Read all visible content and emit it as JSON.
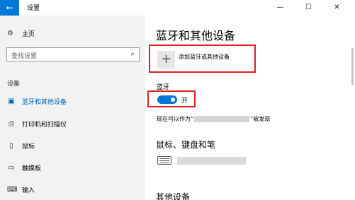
{
  "window": {
    "title": "设置",
    "back_glyph": "←",
    "min_glyph": "—",
    "max_glyph": "☐",
    "close_glyph": "✕"
  },
  "sidebar": {
    "home_label": "主页",
    "search_placeholder": "查找设置",
    "section_label": "设备",
    "items": [
      {
        "label": "蓝牙和其他设备",
        "icon": "bluetooth-devices-icon",
        "active": true
      },
      {
        "label": "打印机和扫描仪",
        "icon": "printer-icon",
        "active": false
      },
      {
        "label": "鼠标",
        "icon": "mouse-icon",
        "active": false
      },
      {
        "label": "触摸板",
        "icon": "touchpad-icon",
        "active": false
      },
      {
        "label": "输入",
        "icon": "keyboard-icon",
        "active": false
      }
    ]
  },
  "main": {
    "title": "蓝牙和其他设备",
    "add_device_label": "添加蓝牙或其他设备",
    "bluetooth_label": "蓝牙",
    "bluetooth_state": "开",
    "discover_prefix": "现在可以作为“",
    "discover_suffix": "”被发现",
    "section_mouse_keyboard_pen": "鼠标、键盘和笔",
    "section_other_devices": "其他设备"
  },
  "colors": {
    "accent": "#0078d7",
    "highlight_box": "#e02020",
    "sidebar_bg": "#f2f2f2"
  }
}
